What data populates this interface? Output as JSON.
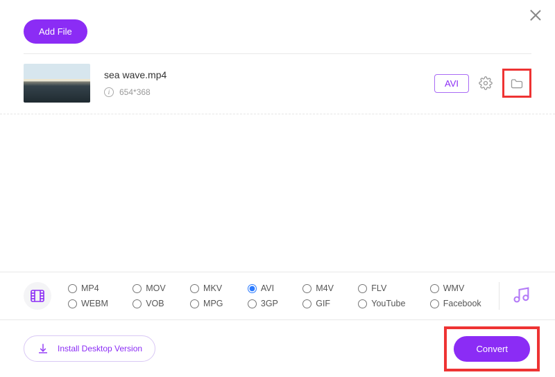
{
  "header": {
    "add_file_label": "Add File"
  },
  "file": {
    "name": "sea wave.mp4",
    "dimensions": "654*368",
    "target_format": "AVI"
  },
  "formats": {
    "row1": [
      "MP4",
      "MOV",
      "MKV",
      "AVI",
      "M4V",
      "FLV",
      "WMV"
    ],
    "row2": [
      "WEBM",
      "VOB",
      "MPG",
      "3GP",
      "GIF",
      "YouTube",
      "Facebook"
    ],
    "selected": "AVI"
  },
  "footer": {
    "install_label": "Install Desktop Version",
    "convert_label": "Convert"
  },
  "colors": {
    "accent": "#8b2cf5",
    "highlight": "#e33"
  }
}
